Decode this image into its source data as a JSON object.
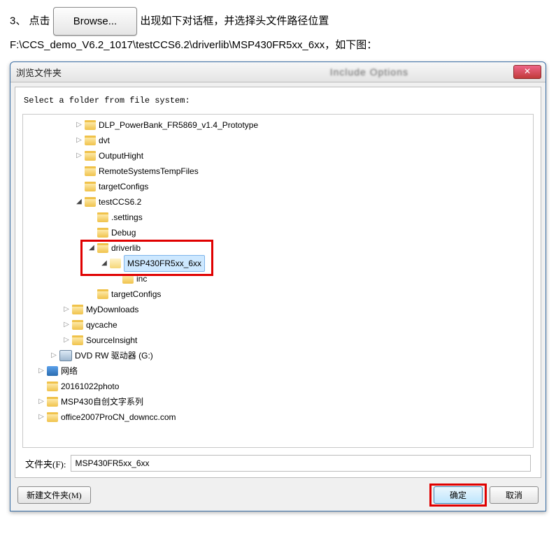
{
  "doc_text": {
    "bullet": "3、",
    "click": "点击",
    "browse_label": "Browse...",
    "after_click": "出现如下对话框，并选择头文件路径位置",
    "path_line": "F:\\CCS_demo_V6.2_1017\\testCCS6.2\\driverlib\\MSP430FR5xx_6xx，如下图："
  },
  "dialog": {
    "title": "浏览文件夹",
    "instruction": "Select a folder from file system:",
    "folder_label": "文件夹(F):",
    "folder_value": "MSP430FR5xx_6xx",
    "buttons": {
      "new_folder": "新建文件夹(M)",
      "ok": "确定",
      "cancel": "取消"
    }
  },
  "tree": [
    {
      "indent": 3,
      "arrow": "closed",
      "icon": "folder",
      "label": "DLP_PowerBank_FR5869_v1.4_Prototype"
    },
    {
      "indent": 3,
      "arrow": "closed",
      "icon": "folder",
      "label": "dvt"
    },
    {
      "indent": 3,
      "arrow": "closed",
      "icon": "folder",
      "label": "OutputHight"
    },
    {
      "indent": 3,
      "arrow": "none",
      "icon": "folder",
      "label": "RemoteSystemsTempFiles"
    },
    {
      "indent": 3,
      "arrow": "none",
      "icon": "folder",
      "label": "targetConfigs"
    },
    {
      "indent": 3,
      "arrow": "open",
      "icon": "folder",
      "label": "testCCS6.2"
    },
    {
      "indent": 4,
      "arrow": "none",
      "icon": "folder",
      "label": ".settings"
    },
    {
      "indent": 4,
      "arrow": "none",
      "icon": "folder",
      "label": "Debug"
    },
    {
      "indent": 4,
      "arrow": "open",
      "icon": "folder",
      "label": "driverlib"
    },
    {
      "indent": 5,
      "arrow": "open",
      "icon": "folder-open",
      "label": "MSP430FR5xx_6xx",
      "selected": true
    },
    {
      "indent": 6,
      "arrow": "none",
      "icon": "folder",
      "label": "inc"
    },
    {
      "indent": 4,
      "arrow": "none",
      "icon": "folder",
      "label": "targetConfigs"
    },
    {
      "indent": 2,
      "arrow": "closed",
      "icon": "folder",
      "label": "MyDownloads"
    },
    {
      "indent": 2,
      "arrow": "closed",
      "icon": "folder",
      "label": "qycache"
    },
    {
      "indent": 2,
      "arrow": "closed",
      "icon": "folder",
      "label": "SourceInsight"
    },
    {
      "indent": 1,
      "arrow": "closed",
      "icon": "drive",
      "label": "DVD RW 驱动器 (G:)"
    },
    {
      "indent": 0,
      "arrow": "closed",
      "icon": "network",
      "label": "网络"
    },
    {
      "indent": 0,
      "arrow": "none",
      "icon": "folder",
      "label": "20161022photo"
    },
    {
      "indent": 0,
      "arrow": "closed",
      "icon": "folder",
      "label": "MSP430自创文字系列"
    },
    {
      "indent": 0,
      "arrow": "closed",
      "icon": "folder",
      "label": "office2007ProCN_downcc.com"
    }
  ]
}
